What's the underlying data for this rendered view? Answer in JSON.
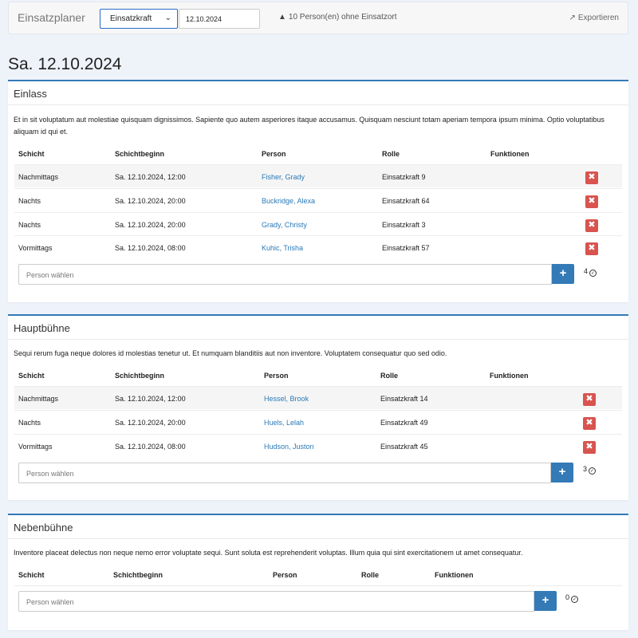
{
  "header": {
    "brand": "Einsatzplaner",
    "role_filter": "Einsatzkraft",
    "date": "12.10.2024",
    "warning": "10 Person(en) ohne Einsatzort",
    "export_label": "Exportieren",
    "icons": {
      "warning": "warning-triangle-icon",
      "export": "export-icon"
    }
  },
  "day_title": "Sa. 12.10.2024",
  "colors": {
    "accent": "#337ab7",
    "danger": "#d9534f",
    "link": "#2a7ab8"
  },
  "columns": [
    "Schicht",
    "Schichtbeginn",
    "Person",
    "Rolle",
    "Funktionen"
  ],
  "panels": [
    {
      "title": "Einlass",
      "description": "Et in sit voluptatum aut molestiae quisquam dignissimos. Sapiente quo autem asperiores itaque accusamus. Quisquam nesciunt totam aperiam tempora ipsum minima. Optio voluptatibus aliquam id qui et.",
      "rows": [
        {
          "shift": "Nachmittags",
          "start": "Sa. 12.10.2024, 12:00",
          "person": "Fisher, Grady",
          "role": "Einsatzkraft 9"
        },
        {
          "shift": "Nachts",
          "start": "Sa. 12.10.2024, 20:00",
          "person": "Buckridge, Alexa",
          "role": "Einsatzkraft 64"
        },
        {
          "shift": "Nachts",
          "start": "Sa. 12.10.2024, 20:00",
          "person": "Grady, Christy",
          "role": "Einsatzkraft 3"
        },
        {
          "shift": "Vormittags",
          "start": "Sa. 12.10.2024, 08:00",
          "person": "Kuhic, Trisha",
          "role": "Einsatzkraft 57"
        }
      ],
      "picker_placeholder": "Person wählen",
      "count": "4"
    },
    {
      "title": "Hauptbühne",
      "description": "Sequi rerum fuga neque dolores id molestias tenetur ut. Et numquam blanditiis aut non inventore. Voluptatem consequatur quo sed odio.",
      "rows": [
        {
          "shift": "Nachmittags",
          "start": "Sa. 12.10.2024, 12:00",
          "person": "Hessel, Brook",
          "role": "Einsatzkraft 14"
        },
        {
          "shift": "Nachts",
          "start": "Sa. 12.10.2024, 20:00",
          "person": "Huels, Lelah",
          "role": "Einsatzkraft 49"
        },
        {
          "shift": "Vormittags",
          "start": "Sa. 12.10.2024, 08:00",
          "person": "Hudson, Juston",
          "role": "Einsatzkraft 45"
        }
      ],
      "picker_placeholder": "Person wählen",
      "count": "3"
    },
    {
      "title": "Nebenbühne",
      "description": "Inventore placeat delectus non neque nemo error voluptate sequi. Sunt soluta est reprehenderit voluptas. Illum quia qui sint exercitationem ut amet consequatur.",
      "rows": [],
      "picker_placeholder": "Person wählen",
      "count": "0"
    }
  ]
}
